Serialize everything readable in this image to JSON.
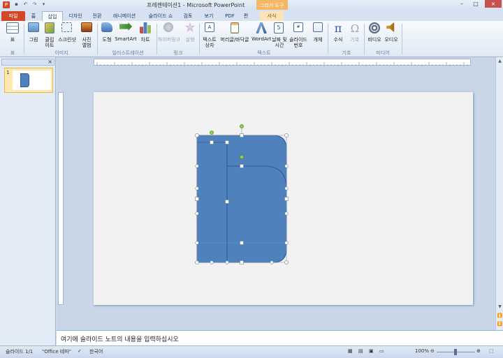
{
  "title_bar": {
    "title": "프레젠테이션1 - Microsoft PowerPoint",
    "context_title": "그리기 도구",
    "app_icon": "P",
    "qat_icons": [
      "save-icon",
      "undo-icon",
      "redo-icon",
      "qat-customize-icon"
    ],
    "window_buttons": [
      "minimize-icon",
      "maximize-icon",
      "close-icon"
    ]
  },
  "tabs": [
    "파일",
    "홈",
    "삽입",
    "디자인",
    "전환",
    "애니메이션",
    "슬라이드 쇼",
    "검토",
    "보기",
    "PDF",
    "편",
    "서식"
  ],
  "ribbon": {
    "groups": [
      {
        "name": "표",
        "items": [
          {
            "label": "표",
            "icon": "table-icon"
          }
        ]
      },
      {
        "name": "이미지",
        "items": [
          {
            "label": "그림",
            "icon": "picture-icon"
          },
          {
            "label": "클립",
            "label2": "아트",
            "icon": "clipart-icon"
          },
          {
            "label": "스크린샷",
            "icon": "screenshot-icon"
          },
          {
            "label": "사진",
            "label2": "앨범",
            "icon": "photo-album-icon"
          }
        ]
      },
      {
        "name": "일러스트레이션",
        "items": [
          {
            "label": "도형",
            "icon": "shapes-icon"
          },
          {
            "label": "SmartArt",
            "icon": "smartart-icon"
          },
          {
            "label": "차트",
            "icon": "chart-icon"
          }
        ]
      },
      {
        "name": "링크",
        "items": [
          {
            "label": "하이퍼링크",
            "icon": "hyperlink-icon"
          },
          {
            "label": "실행",
            "icon": "action-icon"
          }
        ]
      },
      {
        "name": "텍스트",
        "items": [
          {
            "label": "텍스트",
            "label2": "상자",
            "icon": "textbox-icon"
          },
          {
            "label": "머리글/바닥글",
            "icon": "header-footer-icon"
          },
          {
            "label": "WordArt",
            "icon": "wordart-icon"
          },
          {
            "label": "날짜 및",
            "label2": "시간",
            "icon": "date-time-icon"
          },
          {
            "label": "슬라이드",
            "label2": "번호",
            "icon": "slide-number-icon"
          },
          {
            "label": "개체",
            "icon": "object-icon"
          }
        ]
      },
      {
        "name": "기호",
        "items": [
          {
            "label": "수식",
            "icon": "equation-icon"
          },
          {
            "label": "기호",
            "icon": "symbol-icon"
          }
        ]
      },
      {
        "name": "미디어",
        "items": [
          {
            "label": "비디오",
            "icon": "video-icon"
          },
          {
            "label": "오디오",
            "icon": "audio-icon"
          }
        ]
      }
    ]
  },
  "slides_pane": {
    "slide_number": "1",
    "close_icon": "×"
  },
  "notes": {
    "placeholder": "여기에 슬라이드 노트의 내용을 입력하십시오"
  },
  "status_bar": {
    "slide_info": "슬라이드 1/1",
    "theme": "\"Office 테마\"",
    "language": "한국어",
    "zoom": "100%",
    "zoom_level": 1.0
  },
  "colors": {
    "file_tab": "#d24726",
    "shape_fill": "#4f81bd",
    "shape_stroke": "#2f5597",
    "context_tab": "#f4b763"
  }
}
